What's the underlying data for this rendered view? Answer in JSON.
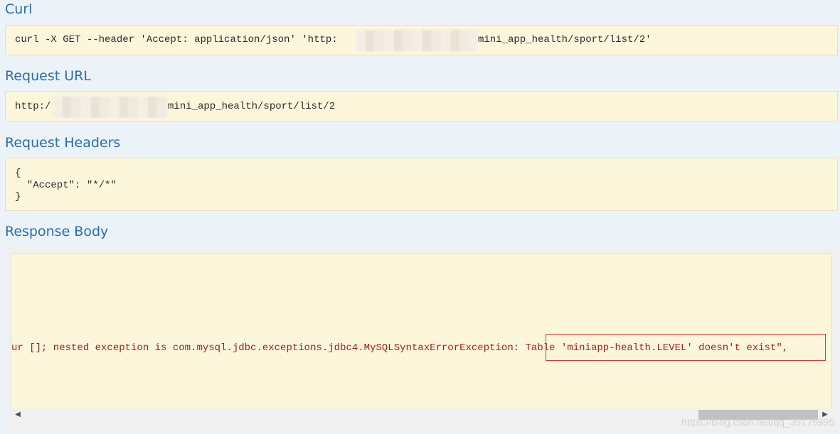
{
  "curl": {
    "title": "Curl",
    "command_prefix": "curl -X GET --header 'Accept: application/json' 'http:",
    "command_suffix": "mini_app_health/sport/list/2'"
  },
  "request_url": {
    "title": "Request URL",
    "prefix": "http:/",
    "suffix": "mini_app_health/sport/list/2"
  },
  "request_headers": {
    "title": "Request Headers",
    "lines": [
      "{",
      "  \"Accept\": \"*/*\"",
      "}"
    ]
  },
  "response_body": {
    "title": "Response Body",
    "error_prefix": "ur []; nested exception is com.mysql.jdbc.exceptions.jdbc4.MySQLSyntaxErrorException: ",
    "error_highlight": "Table 'miniapp-health.LEVEL' doesn't exist\"",
    "error_tail": ","
  },
  "watermark": "https://blog.csdn.net/qq_35175995",
  "icons": {
    "scroll_left": "◀",
    "scroll_right": "▶"
  },
  "colors": {
    "title": "#2b6ea8",
    "code_bg": "#fcf6db",
    "error_text": "#a11f1f",
    "highlight_border": "#d53a3a"
  }
}
